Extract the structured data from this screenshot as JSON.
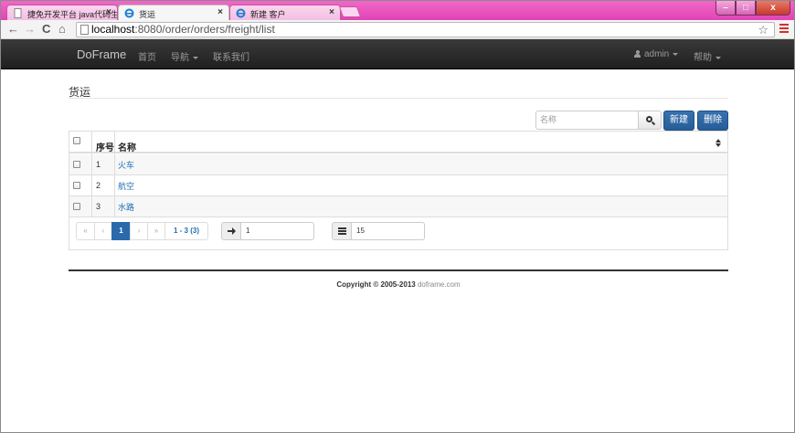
{
  "browser": {
    "tabs": [
      {
        "title": "捷免开发平台 java代码生",
        "close": "×"
      },
      {
        "title": "货运",
        "close": "×"
      },
      {
        "title": "新建 客户",
        "close": "×"
      }
    ],
    "window_buttons": {
      "minimize": "–",
      "maximize": "□",
      "close": "x"
    },
    "nav": {
      "back": "←",
      "forward": "→",
      "reload": "C",
      "home": "⌂"
    },
    "url": {
      "host": "localhost",
      "rest": ":8080/order/orders/freight/list"
    },
    "star": "☆"
  },
  "navbar": {
    "brand": "DoFrame",
    "home": "首页",
    "nav": "导航",
    "contact": "联系我们",
    "user": "admin",
    "help": "帮助"
  },
  "page": {
    "title": "货运",
    "search_placeholder": "名称",
    "new_button": "新建",
    "delete_button": "删除"
  },
  "table": {
    "headers": {
      "index": "序号",
      "name": "名称"
    },
    "rows": [
      {
        "index": "1",
        "name": "火车"
      },
      {
        "index": "2",
        "name": "航空"
      },
      {
        "index": "3",
        "name": "水路"
      }
    ]
  },
  "pager": {
    "first": "«",
    "prev": "‹",
    "current": "1",
    "next": "›",
    "last": "»",
    "info": "1 - 3 (3)",
    "jump_value": "1",
    "page_size": "15"
  },
  "footer": {
    "copyright": "Copyright © 2005-2013",
    "site": "doframe.com"
  }
}
